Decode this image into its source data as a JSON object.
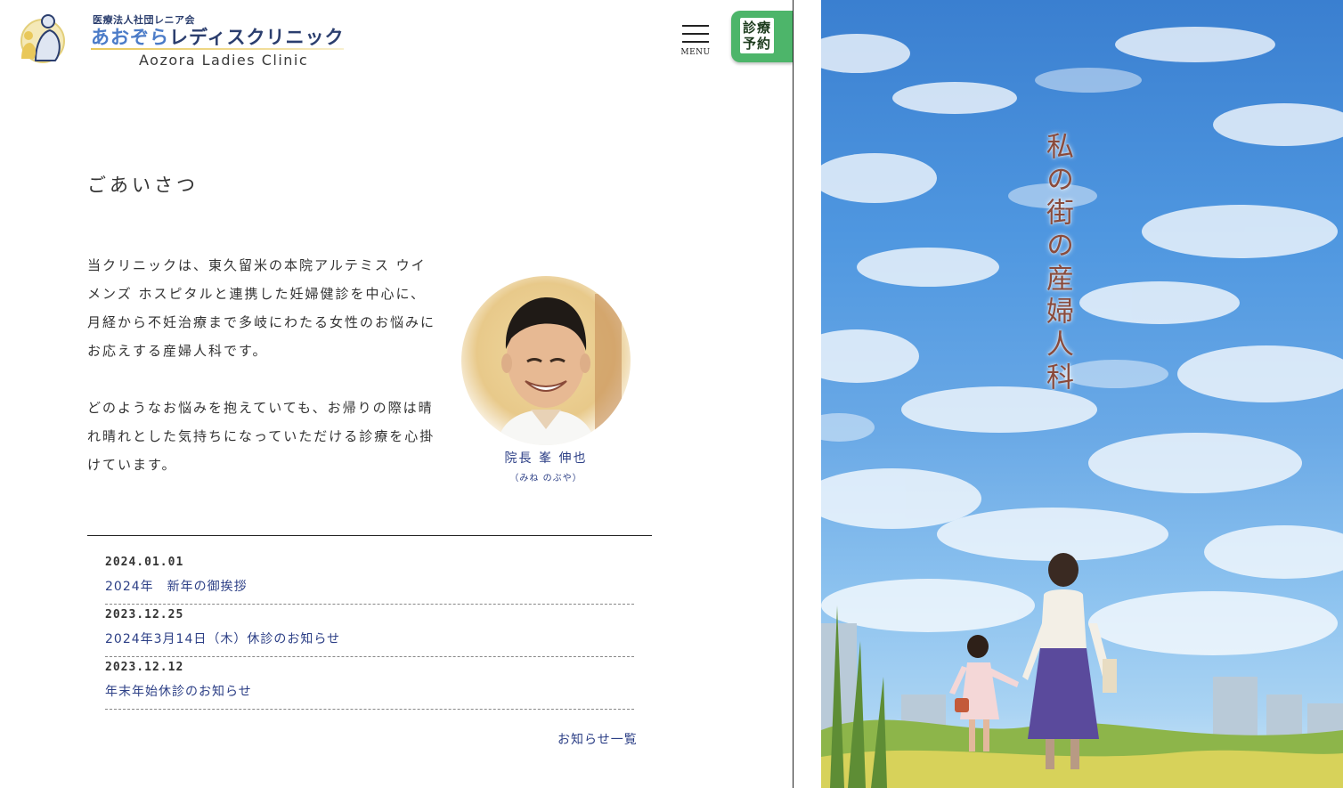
{
  "header": {
    "org_name": "医療法人社団レニア会",
    "clinic_name_hira": "あおぞら",
    "clinic_name_kata": "レディスクリニック",
    "clinic_name_en": "Aozora Ladies Clinic",
    "menu_label": "MENU",
    "reserve_line1": "診療",
    "reserve_line2": "予約",
    "reserve_color": "#4db56a"
  },
  "greeting": {
    "title": "ごあいさつ",
    "paragraphs": [
      "当クリニックは、東久留米の本院アルテミス ウイメンズ ホスピタルと連携した妊婦健診を中心に、月経から不妊治療まで多岐にわたる女性のお悩みにお応えする産婦人科です。",
      "どのようなお悩みを抱えていても、お帰りの際は晴れ晴れとした気持ちになっていただける診療を心掛けています。"
    ],
    "director_name": "院長 峯 伸也",
    "director_reading": "（みね のぶや）"
  },
  "news": {
    "items": [
      {
        "date": "2024.01.01",
        "title": "2024年　新年の御挨拶"
      },
      {
        "date": "2023.12.25",
        "title": "2024年3月14日（木）休診のお知らせ"
      },
      {
        "date": "2023.12.12",
        "title": "年末年始休診のお知らせ"
      }
    ],
    "all_link": "お知らせ一覧"
  },
  "hero": {
    "tagline": "私の街の産婦人科"
  },
  "colors": {
    "accent_navy": "#2c3f86",
    "sky_blue": "#4f97e0",
    "tagline_brown": "#8a4b3c"
  }
}
